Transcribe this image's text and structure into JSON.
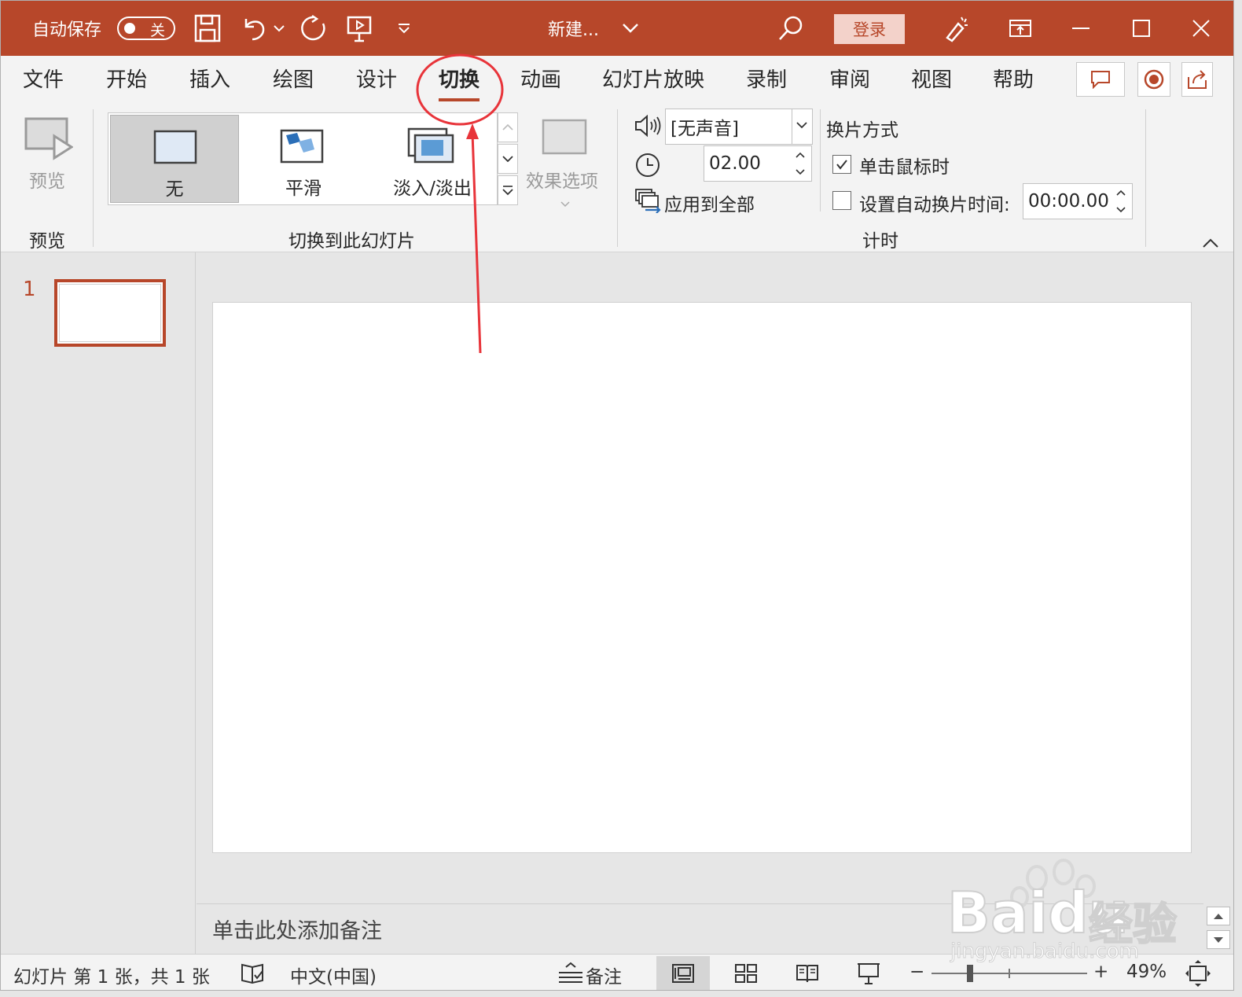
{
  "titlebar": {
    "autosave_label": "自动保存",
    "autosave_state": "关",
    "doc_title": "新建...",
    "login_label": "登录"
  },
  "tabs": [
    "文件",
    "开始",
    "插入",
    "绘图",
    "设计",
    "切换",
    "动画",
    "幻灯片放映",
    "录制",
    "审阅",
    "视图",
    "帮助"
  ],
  "active_tab": "切换",
  "ribbon": {
    "preview_button": "预览",
    "preview_group": "预览",
    "transitions": [
      {
        "label": "无",
        "selected": true
      },
      {
        "label": "平滑",
        "selected": false
      },
      {
        "label": "淡入/淡出",
        "selected": false
      }
    ],
    "effect_options": "效果选项",
    "transition_group": "切换到此幻灯片",
    "sound_value": "[无声音]",
    "duration_value": "02.00",
    "apply_all": "应用到全部",
    "advance_title": "换片方式",
    "on_click_label": "单击鼠标时",
    "on_click_checked": true,
    "after_label": "设置自动换片时间:",
    "after_checked": false,
    "after_value": "00:00.00",
    "timing_group": "计时"
  },
  "slides_panel": {
    "slide_number": "1"
  },
  "notes_placeholder": "单击此处添加备注",
  "statusbar": {
    "slide_info": "幻灯片 第 1 张，共 1 张",
    "language": "中文(中国)",
    "notes_label": "备注",
    "zoom_minus": "−",
    "zoom_plus": "+",
    "zoom_level": "49%",
    "zoom_fraction": 0.49
  },
  "watermark": {
    "brand": "Baidu",
    "suffix": "经验",
    "url": "jingyan.baidu.com"
  },
  "colors": {
    "accent": "#b7472a",
    "annotation": "#e8343a"
  }
}
